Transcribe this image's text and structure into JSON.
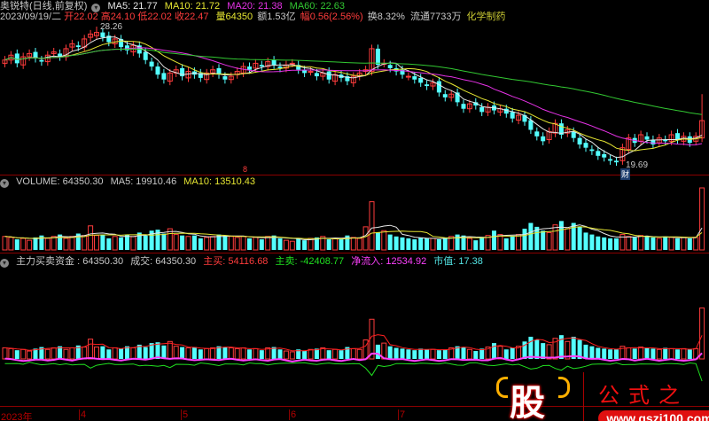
{
  "header": {
    "stock_name": "奥锐特(日线,前复权)",
    "ma5": "MA5: 21.77",
    "ma10": "MA10: 21.72",
    "ma20": "MA20: 21.38",
    "ma60": "MA60: 22.63",
    "date": "2023/09/19/二",
    "open": "开22.02",
    "high": "高24.10",
    "low": "低22.02",
    "close": "收22.47",
    "volume": "量64350",
    "amount": "额1.53亿",
    "change": "幅0.56(2.56%)",
    "turnover": "换8.32%",
    "float": "流通7733万",
    "sector": "化学制药"
  },
  "price_panel": {
    "max_label": "28.26",
    "min_label": "19.69",
    "news_badge": "财",
    "marker": "8"
  },
  "volume_panel": {
    "volume": "VOLUME: 64350.30",
    "ma5": "MA5: 19910.46",
    "ma10": "MA10: 13510.43"
  },
  "fund_panel": {
    "title": "主力买卖资金 : 64350.30",
    "deal": "成交: 64350.30",
    "main_buy": "主买: 54116.68",
    "main_sell": "主卖: -42408.77",
    "net_inflow": "净流入: 12534.92",
    "market_value": "市值: 17.38"
  },
  "x_axis": [
    "2023年",
    "4",
    "5",
    "6",
    "7"
  ],
  "logo": {
    "char": "股",
    "name": "公式之家",
    "url": "www.gszj100.com"
  },
  "colors": {
    "up": "#ff3c3c",
    "down": "#54ffff",
    "ma5": "#e6e6e6",
    "ma10": "#e6e632",
    "ma20": "#e632e6",
    "ma60": "#32c832",
    "net": "#ff40ff",
    "sell": "#20e020"
  },
  "chart_data": {
    "type": "candlestick",
    "price_range": [
      19.69,
      28.26
    ],
    "close": [
      26.2,
      26.5,
      26.0,
      26.4,
      26.6,
      26.3,
      26.1,
      26.5,
      26.7,
      26.4,
      26.9,
      27.2,
      27.0,
      27.5,
      27.8,
      27.9,
      27.6,
      27.3,
      27.5,
      27.0,
      26.8,
      27.1,
      26.6,
      26.2,
      25.8,
      25.3,
      25.0,
      25.4,
      25.6,
      25.2,
      25.5,
      25.3,
      25.1,
      25.4,
      25.6,
      25.3,
      25.0,
      25.2,
      25.5,
      25.8,
      25.6,
      26.0,
      25.8,
      26.1,
      25.9,
      25.7,
      25.9,
      26.0,
      25.6,
      25.4,
      25.5,
      25.2,
      25.4,
      25.0,
      25.3,
      25.1,
      24.9,
      25.2,
      25.4,
      25.6,
      26.9,
      25.9,
      26.0,
      25.7,
      25.5,
      25.3,
      25.2,
      25.0,
      24.8,
      24.6,
      24.8,
      24.2,
      23.9,
      24.1,
      23.6,
      23.2,
      23.5,
      23.4,
      23.0,
      23.3,
      23.1,
      23.2,
      22.9,
      22.6,
      22.8,
      22.4,
      21.9,
      21.5,
      21.2,
      21.8,
      22.3,
      21.6,
      21.9,
      21.4,
      21.0,
      20.8,
      20.6,
      20.3,
      20.2,
      20.0,
      19.9,
      20.8,
      21.4,
      21.1,
      21.6,
      21.3,
      21.0,
      21.4,
      21.2,
      21.6,
      21.3,
      21.5,
      21.1,
      21.5,
      22.47
    ],
    "volume": [
      14000,
      13000,
      11000,
      12000,
      10000,
      13000,
      15000,
      12000,
      14000,
      16000,
      12000,
      14000,
      17000,
      15000,
      25000,
      15000,
      16000,
      12000,
      14000,
      13000,
      16000,
      14000,
      18000,
      15000,
      20000,
      21000,
      17000,
      22000,
      16000,
      15000,
      14000,
      15000,
      12000,
      13000,
      14000,
      16000,
      15000,
      14000,
      13000,
      14000,
      12000,
      13000,
      11000,
      14000,
      15000,
      12000,
      10000,
      9000,
      12000,
      10000,
      12000,
      13000,
      14000,
      11000,
      12000,
      11000,
      15000,
      13000,
      12000,
      24000,
      50000,
      18000,
      20000,
      16000,
      14000,
      13000,
      12000,
      11000,
      13000,
      12000,
      12000,
      11000,
      12000,
      14000,
      16000,
      15000,
      12000,
      10000,
      13000,
      15000,
      20000,
      16000,
      12000,
      14000,
      16000,
      22000,
      28000,
      24000,
      20000,
      18000,
      26000,
      30000,
      22000,
      28000,
      24000,
      18000,
      16000,
      14000,
      13000,
      12000,
      12000,
      16000,
      14000,
      13000,
      15000,
      14000,
      13000,
      12000,
      14000,
      13000,
      12000,
      13000,
      12000,
      13000,
      64350
    ]
  }
}
